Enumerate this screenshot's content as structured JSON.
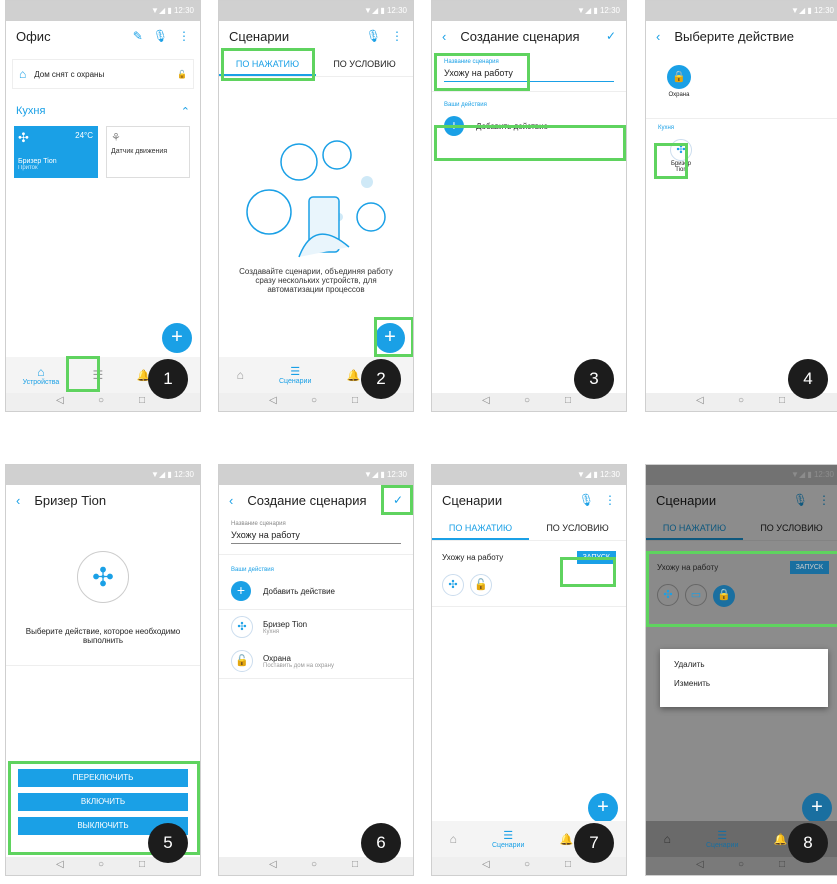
{
  "status_time": "12:30",
  "badges": [
    "1",
    "2",
    "3",
    "4",
    "5",
    "6",
    "7",
    "8"
  ],
  "p1": {
    "title": "Офис",
    "row_home": "Дом снят с охраны",
    "section": "Кухня",
    "card1_name": "Бризер Tion",
    "card1_sub": "Приток",
    "card1_temp": "24°C",
    "card2_name": "Датчик движения",
    "nav_devices": "Устройства"
  },
  "p2": {
    "title": "Сценарии",
    "tab1": "ПО НАЖАТИЮ",
    "tab2": "ПО УСЛОВИЮ",
    "empty_text": "Создавайте сценарии, объединяя работу сразу нескольких устройств, для автоматизации процессов",
    "nav_scenarios": "Сценарии"
  },
  "p3": {
    "title": "Создание сценария",
    "field_label": "Название сценария",
    "field_value": "Ухожу на работу",
    "section": "Ваши действия",
    "add_action": "Добавить действие"
  },
  "p4": {
    "title": "Выберите действие",
    "guard": "Охрана",
    "section": "Кухня",
    "breezer": "Бризер Tion"
  },
  "p5": {
    "title": "Бризер Tion",
    "prompt": "Выберите действие, которое необходимо выполнить",
    "btn_toggle": "ПЕРЕКЛЮЧИТЬ",
    "btn_on": "ВКЛЮЧИТЬ",
    "btn_off": "ВЫКЛЮЧИТЬ"
  },
  "p6": {
    "title": "Создание сценария",
    "field_label": "Название сценария",
    "field_value": "Ухожу на работу",
    "section": "Ваши действия",
    "add_action": "Добавить действие",
    "item1": "Бризер Tion",
    "item1_sub": "Кухня",
    "item2": "Охрана",
    "item2_sub": "Поставить дом на охрану"
  },
  "p7": {
    "title": "Сценарии",
    "tab1": "ПО НАЖАТИЮ",
    "tab2": "ПО УСЛОВИЮ",
    "scenario": "Ухожу на работу",
    "run": "ЗАПУСК",
    "nav_scenarios": "Сценарии"
  },
  "p8": {
    "title": "Сценарии",
    "tab1": "ПО НАЖАТИЮ",
    "tab2": "ПО УСЛОВИЮ",
    "scenario": "Ухожу на работу",
    "run": "ЗАПУСК",
    "menu_delete": "Удалить",
    "menu_edit": "Изменить",
    "nav_scenarios": "Сценарии"
  }
}
